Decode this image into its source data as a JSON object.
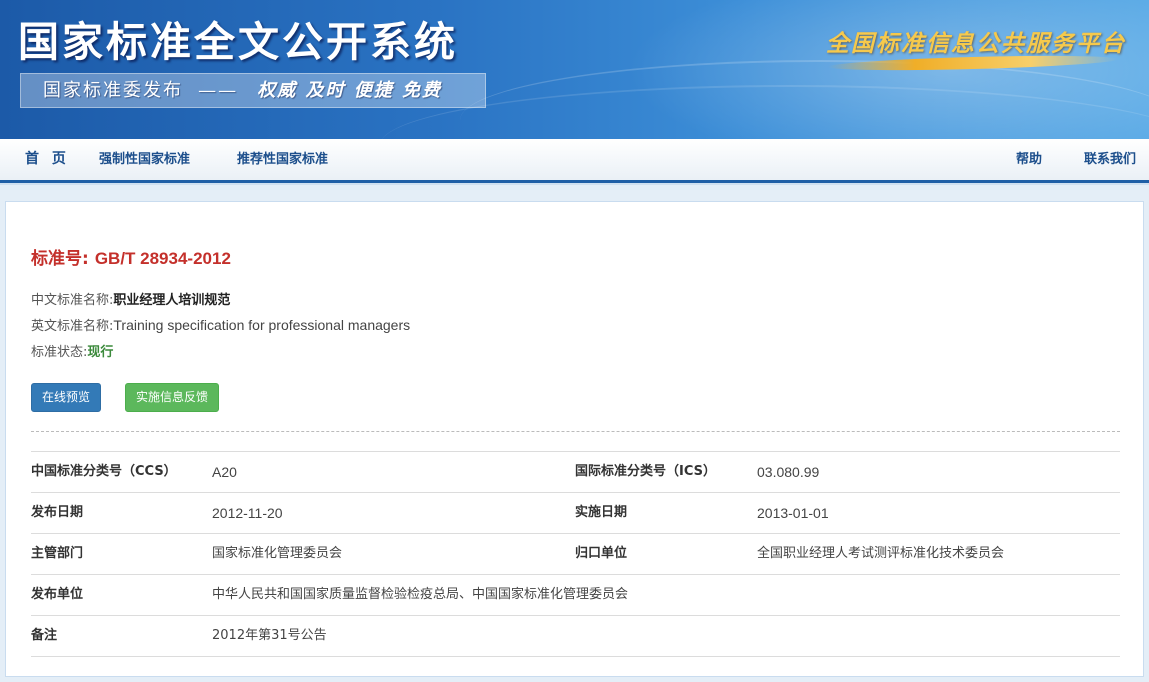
{
  "banner": {
    "site_title": "国家标准全文公开系统",
    "slogan_left": "国家标准委发布",
    "slogan_dash": "——",
    "slogan_right": "权威 及时 便捷 免费",
    "platform": "全国标准信息公共服务平台"
  },
  "nav": {
    "left": [
      "首 页",
      "强制性国家标准",
      "推荐性国家标准"
    ],
    "right": [
      "帮助",
      "联系我们"
    ]
  },
  "standard": {
    "number_label": "标准号:",
    "number": "GB/T 28934-2012",
    "cn_name_label": "中文标准名称:",
    "cn_name": "职业经理人培训规范",
    "en_name_label": "英文标准名称:",
    "en_name": "Training specification for professional managers",
    "status_label": "标准状态:",
    "status": "现行",
    "status_color": "#3c8a3c"
  },
  "buttons": {
    "preview": "在线预览",
    "feedback": "实施信息反馈"
  },
  "meta": {
    "rows": [
      {
        "l1": "中国标准分类号（CCS）",
        "v1": "A20",
        "l2": "国际标准分类号（ICS）",
        "v2": "03.080.99"
      },
      {
        "l1": "发布日期",
        "v1": "2012-11-20",
        "l2": "实施日期",
        "v2": "2013-01-01"
      },
      {
        "l1": "主管部门",
        "v1": "国家标准化管理委员会",
        "l2": "归口单位",
        "v2": "全国职业经理人考试测评标准化技术委员会"
      },
      {
        "l1": "发布单位",
        "v1": "中华人民共和国国家质量监督检验检疫总局、中国国家标准化管理委员会",
        "l2": "",
        "v2": ""
      },
      {
        "l1": "备注",
        "v1": "2012年第31号公告",
        "l2": "",
        "v2": ""
      }
    ]
  },
  "colors": {
    "banner_blue": "#2a73c3",
    "nav_text": "#1d4f8c",
    "std_red": "#c4302b",
    "btn_blue": "#337ab7",
    "btn_green": "#5cb85c"
  }
}
